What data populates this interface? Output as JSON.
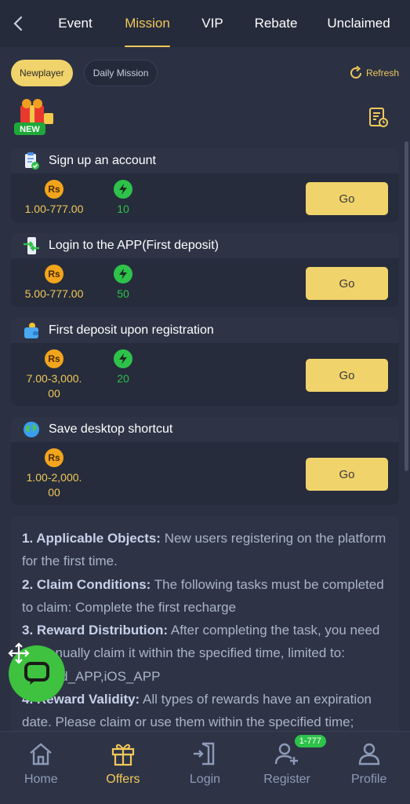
{
  "tabs": [
    "Event",
    "Mission",
    "VIP",
    "Rebate",
    "Unclaimed"
  ],
  "active_tab": "Mission",
  "filters": {
    "newplayer": "Newplayer",
    "daily": "Daily Mission",
    "refresh": "Refresh"
  },
  "new_badge": "NEW",
  "tasks": [
    {
      "title": "Sign up an account",
      "reward": "1.00-777.00",
      "points": "10",
      "go": "Go"
    },
    {
      "title": "Login to the APP(First deposit)",
      "reward": "5.00-777.00",
      "points": "50",
      "go": "Go"
    },
    {
      "title": "First deposit upon registration",
      "reward_line1": "7.00-3,000.",
      "reward_line2": "00",
      "points": "20",
      "go": "Go"
    },
    {
      "title": "Save desktop shortcut",
      "reward_line1": "1.00-2,000.",
      "reward_line2": "00",
      "go": "Go"
    }
  ],
  "currency_symbol": "Rs",
  "rules": [
    {
      "label": "1. Applicable Objects:",
      "text": " New users registering on the platform for the first time."
    },
    {
      "label": "2. Claim Conditions:",
      "text": " The following tasks must be completed to claim: Complete the first recharge"
    },
    {
      "label": "3. Reward Distribution:",
      "text": " After completing the task, you need to manually claim it within the specified time, limited to: Android_APP,iOS_APP"
    },
    {
      "label": "4. Reward Validity:",
      "text": " All types of rewards have an expiration date. Please claim or use them within the specified time;"
    }
  ],
  "bottom_nav": [
    {
      "label": "Home",
      "icon": "home-icon"
    },
    {
      "label": "Offers",
      "icon": "gift-icon"
    },
    {
      "label": "Login",
      "icon": "login-icon"
    },
    {
      "label": "Register",
      "icon": "register-icon"
    },
    {
      "label": "Profile",
      "icon": "profile-icon"
    }
  ],
  "register_badge": "1-777",
  "colors": {
    "accent": "#f1c85a",
    "green": "#2ec24a",
    "background": "#2b3143",
    "button": "#f1d36b"
  }
}
